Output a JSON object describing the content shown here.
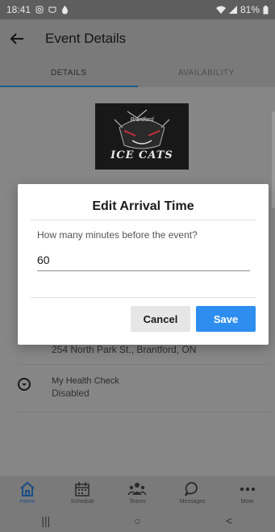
{
  "status_bar": {
    "time": "18:41",
    "battery": "81%"
  },
  "app_bar": {
    "title": "Event Details"
  },
  "tabs": [
    {
      "label": "DETAILS"
    },
    {
      "label": "AVAILABILITY"
    }
  ],
  "logo": {
    "brand": "Brantford",
    "name": "ICE CATS"
  },
  "event": {
    "address": "254 North Park St., Brantford, ON",
    "health_check": {
      "title": "My Health Check",
      "status": "Disabled"
    }
  },
  "dialog": {
    "title": "Edit Arrival Time",
    "prompt": "How many minutes before the event?",
    "value": "60",
    "cancel_label": "Cancel",
    "save_label": "Save"
  },
  "bottom_nav": [
    {
      "label": "Home",
      "icon": "home-icon"
    },
    {
      "label": "Schedule",
      "icon": "calendar-icon"
    },
    {
      "label": "Teams",
      "icon": "teams-icon"
    },
    {
      "label": "Messages",
      "icon": "chat-bubble-icon"
    },
    {
      "label": "More",
      "icon": "more-dots-icon"
    }
  ],
  "system_nav": {
    "recents": "|||",
    "home": "○",
    "back": "<"
  },
  "colors": {
    "accent": "#2e8ef0",
    "active_nav": "#1a4e86",
    "scrim": "#8a8a8a"
  }
}
